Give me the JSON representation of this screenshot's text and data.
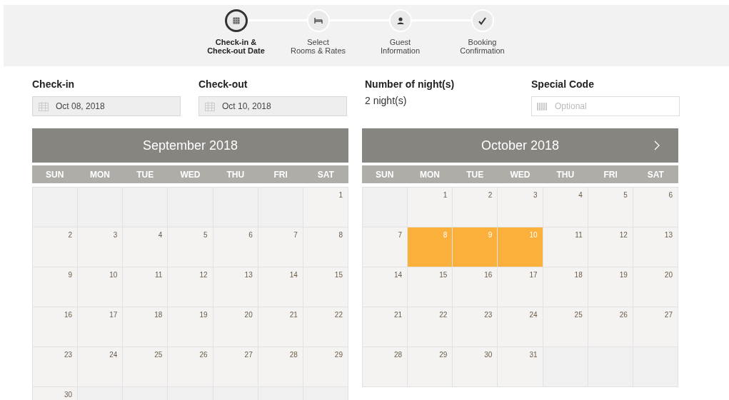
{
  "steps": [
    {
      "kind": "calendar",
      "label_lines": [
        "Check-in &",
        "Check-out Date"
      ],
      "selected": true
    },
    {
      "kind": "bed",
      "label_lines": [
        "Select",
        "Rooms & Rates"
      ],
      "selected": false
    },
    {
      "kind": "person",
      "label_lines": [
        "Guest",
        "Information"
      ],
      "selected": false
    },
    {
      "kind": "check",
      "label_lines": [
        "Booking",
        "Confirmation"
      ],
      "selected": false
    }
  ],
  "fields": [
    {
      "kind": "date",
      "label": "Check-in",
      "value": "Oct 08, 2018"
    },
    {
      "kind": "date",
      "label": "Check-out",
      "value": "Oct 10, 2018"
    },
    {
      "kind": "text",
      "label": "Number of night(s)",
      "value": "2 night(s)"
    },
    {
      "kind": "code",
      "label": "Special Code",
      "placeholder": "Optional"
    }
  ],
  "calendars": [
    {
      "title": "September 2018",
      "has_next": false,
      "weekdays": [
        "SUN",
        "MON",
        "TUE",
        "WED",
        "THU",
        "FRI",
        "SAT"
      ],
      "weeks": [
        [
          {
            "kind": "blank"
          },
          {
            "kind": "blank"
          },
          {
            "kind": "blank"
          },
          {
            "kind": "blank"
          },
          {
            "kind": "blank"
          },
          {
            "kind": "blank"
          },
          {
            "kind": "day",
            "day": "1",
            "selected": false
          }
        ],
        [
          {
            "kind": "day",
            "day": "2",
            "selected": false
          },
          {
            "kind": "day",
            "day": "3",
            "selected": false
          },
          {
            "kind": "day",
            "day": "4",
            "selected": false
          },
          {
            "kind": "day",
            "day": "5",
            "selected": false
          },
          {
            "kind": "day",
            "day": "6",
            "selected": false
          },
          {
            "kind": "day",
            "day": "7",
            "selected": false
          },
          {
            "kind": "day",
            "day": "8",
            "selected": false
          }
        ],
        [
          {
            "kind": "day",
            "day": "9",
            "selected": false
          },
          {
            "kind": "day",
            "day": "10",
            "selected": false
          },
          {
            "kind": "day",
            "day": "11",
            "selected": false
          },
          {
            "kind": "day",
            "day": "12",
            "selected": false
          },
          {
            "kind": "day",
            "day": "13",
            "selected": false
          },
          {
            "kind": "day",
            "day": "14",
            "selected": false
          },
          {
            "kind": "day",
            "day": "15",
            "selected": false
          }
        ],
        [
          {
            "kind": "day",
            "day": "16",
            "selected": false
          },
          {
            "kind": "day",
            "day": "17",
            "selected": false
          },
          {
            "kind": "day",
            "day": "18",
            "selected": false
          },
          {
            "kind": "day",
            "day": "19",
            "selected": false
          },
          {
            "kind": "day",
            "day": "20",
            "selected": false
          },
          {
            "kind": "day",
            "day": "21",
            "selected": false
          },
          {
            "kind": "day",
            "day": "22",
            "selected": false
          }
        ],
        [
          {
            "kind": "day",
            "day": "23",
            "selected": false
          },
          {
            "kind": "day",
            "day": "24",
            "selected": false
          },
          {
            "kind": "day",
            "day": "25",
            "selected": false
          },
          {
            "kind": "day",
            "day": "26",
            "selected": false
          },
          {
            "kind": "day",
            "day": "27",
            "selected": false
          },
          {
            "kind": "day",
            "day": "28",
            "selected": false
          },
          {
            "kind": "day",
            "day": "29",
            "selected": false
          }
        ],
        [
          {
            "kind": "day",
            "day": "30",
            "selected": false
          },
          {
            "kind": "blank"
          },
          {
            "kind": "blank"
          },
          {
            "kind": "blank"
          },
          {
            "kind": "blank"
          },
          {
            "kind": "blank"
          },
          {
            "kind": "blank"
          }
        ]
      ]
    },
    {
      "title": "October 2018",
      "has_next": true,
      "weekdays": [
        "SUN",
        "MON",
        "TUE",
        "WED",
        "THU",
        "FRI",
        "SAT"
      ],
      "weeks": [
        [
          {
            "kind": "blank"
          },
          {
            "kind": "day",
            "day": "1",
            "selected": false
          },
          {
            "kind": "day",
            "day": "2",
            "selected": false
          },
          {
            "kind": "day",
            "day": "3",
            "selected": false
          },
          {
            "kind": "day",
            "day": "4",
            "selected": false
          },
          {
            "kind": "day",
            "day": "5",
            "selected": false
          },
          {
            "kind": "day",
            "day": "6",
            "selected": false
          }
        ],
        [
          {
            "kind": "day",
            "day": "7",
            "selected": false
          },
          {
            "kind": "day",
            "day": "8",
            "selected": true
          },
          {
            "kind": "day",
            "day": "9",
            "selected": true
          },
          {
            "kind": "day",
            "day": "10",
            "selected": true
          },
          {
            "kind": "day",
            "day": "11",
            "selected": false
          },
          {
            "kind": "day",
            "day": "12",
            "selected": false
          },
          {
            "kind": "day",
            "day": "13",
            "selected": false
          }
        ],
        [
          {
            "kind": "day",
            "day": "14",
            "selected": false
          },
          {
            "kind": "day",
            "day": "15",
            "selected": false
          },
          {
            "kind": "day",
            "day": "16",
            "selected": false
          },
          {
            "kind": "day",
            "day": "17",
            "selected": false
          },
          {
            "kind": "day",
            "day": "18",
            "selected": false
          },
          {
            "kind": "day",
            "day": "19",
            "selected": false
          },
          {
            "kind": "day",
            "day": "20",
            "selected": false
          }
        ],
        [
          {
            "kind": "day",
            "day": "21",
            "selected": false
          },
          {
            "kind": "day",
            "day": "22",
            "selected": false
          },
          {
            "kind": "day",
            "day": "23",
            "selected": false
          },
          {
            "kind": "day",
            "day": "24",
            "selected": false
          },
          {
            "kind": "day",
            "day": "25",
            "selected": false
          },
          {
            "kind": "day",
            "day": "26",
            "selected": false
          },
          {
            "kind": "day",
            "day": "27",
            "selected": false
          }
        ],
        [
          {
            "kind": "day",
            "day": "28",
            "selected": false
          },
          {
            "kind": "day",
            "day": "29",
            "selected": false
          },
          {
            "kind": "day",
            "day": "30",
            "selected": false
          },
          {
            "kind": "day",
            "day": "31",
            "selected": false
          },
          {
            "kind": "blank"
          },
          {
            "kind": "blank"
          },
          {
            "kind": "blank"
          }
        ]
      ]
    }
  ]
}
